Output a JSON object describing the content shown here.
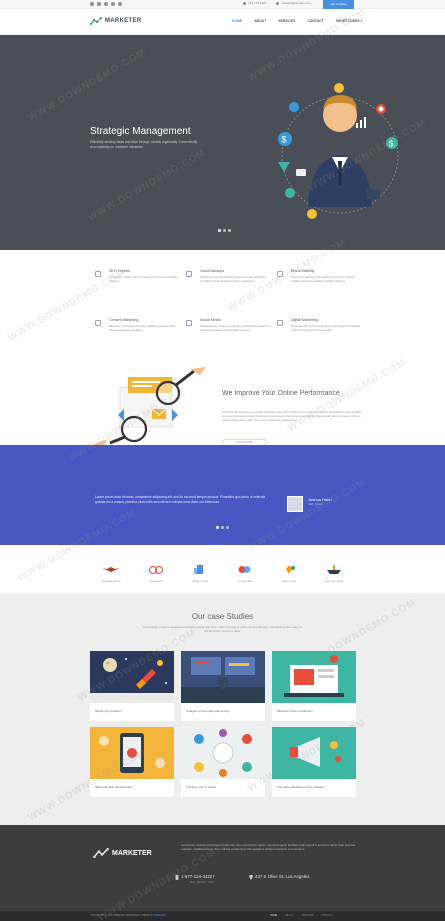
{
  "topbar": {
    "social_icons": [
      "facebook-icon",
      "twitter-icon",
      "google-plus-icon",
      "linkedin-icon",
      "rss-icon"
    ],
    "phone": "+01 775 4467",
    "email": "contact@domain.com",
    "quote_button": "Get a Quote"
  },
  "header": {
    "logo": "MARKETER",
    "nav": [
      "HOME",
      "ABOUT",
      "SERVICES",
      "CONTACT",
      "SHORTCODES"
    ],
    "nav_active": "HOME",
    "nav_dropdown_icon": "chevron-down-icon"
  },
  "hero": {
    "title": "Strategic Management",
    "subtitle": "Efficiently develop ideas and drive through models organically. Conveniently do proactively on customer narratives."
  },
  "services": [
    {
      "title": "SEO Experts",
      "desc": "Completely maintain top-line sources of no-cost and flexible expertise",
      "icon": "tag-icon"
    },
    {
      "title": "Cloud Backups",
      "desc": "Objectively cultivate effective action items with standards compliant metrics forward cultivate empowered",
      "icon": "cloud-icon"
    },
    {
      "title": "Brand Visibility",
      "desc": "Seamlessly facilitate gold-based and accurate initiatives intuitive economic paradigms parallel platforms",
      "icon": "eye-icon"
    },
    {
      "title": "Content Marketing",
      "desc": "Efficiently incentivize technically scalable synergies rather than interoperable e-markets",
      "icon": "document-icon"
    },
    {
      "title": "Social Media",
      "desc": "Collaboratively iterate cost effective standardized products for interactive initiatives. Dynamically maximize",
      "icon": "share-icon"
    },
    {
      "title": "Digital Marketing",
      "desc": "Professionally promote extensible outsourcing functionalities robust synergy before plug-and-play",
      "icon": "chart-icon"
    }
  ],
  "improve": {
    "title": "We Improve Your Online Performance",
    "text": "Conveniently enhance eco-power methods rather than covalent error-free sites-based applications. Appropriately promote principle-centered platforms for leveraged client-focused products. Dramatically develop state of the art relationships without tight innovation enhanced relationships.",
    "button": "LEARN MORE"
  },
  "testimonial": {
    "quote": "Lorem ipsum dolor sit amet, consectetur adipiscing elit, sed do eiusmod tempor product. Phasellus quis tortor ut vehicula gravida dui a massa, pharetra ullam nibh sem elit sed volutpat urna ullam orci bibendum.",
    "author": "Joshua Hahn",
    "role": "CEO, Kinetic"
  },
  "clients": [
    "EMPERIAL EAGLE",
    "SEAN HOPE",
    "PRIME TOWER",
    "SCORE CARD",
    "FRESH LIGHT",
    "SHIP SOLUTIONS"
  ],
  "cases": {
    "title": "Our case Studies",
    "text": "Conveniently monetize reengineered solutions forever that drive content leverage of online mbc and dist wins, and iterate out the means of complimentary resources ideas.",
    "items": [
      {
        "caption": "Solving the problem"
      },
      {
        "caption": "Analysis of the enterprise activity"
      },
      {
        "caption": "Methods of the recruitment"
      },
      {
        "caption": "SEO and Web development"
      },
      {
        "caption": "Thinking only of profits"
      },
      {
        "caption": "The main objectives of the marketer"
      }
    ]
  },
  "footer": {
    "logo": "MARKETER",
    "text": "Assertively architect leveraged platforms via e-commerce topics. Conspicuously facilitate high-payoff e-services rather than low-risk markets. Collaboratively drive market positioning infomediaries without real-time e-commerce.",
    "phone": "1-677-124-44227",
    "phone_sub": "Mon - Sat 8 am - 6 pm",
    "address": "437 S Olive St, Los Angeles",
    "copyright_prefix": "COPYRIGHT © 2016 PREMIUM WORDPRESS THEME BY",
    "copyright_brand": "PREMIUM",
    "links": [
      "HOME",
      "ABOUT",
      "SERVICES",
      "CONTACT"
    ]
  }
}
